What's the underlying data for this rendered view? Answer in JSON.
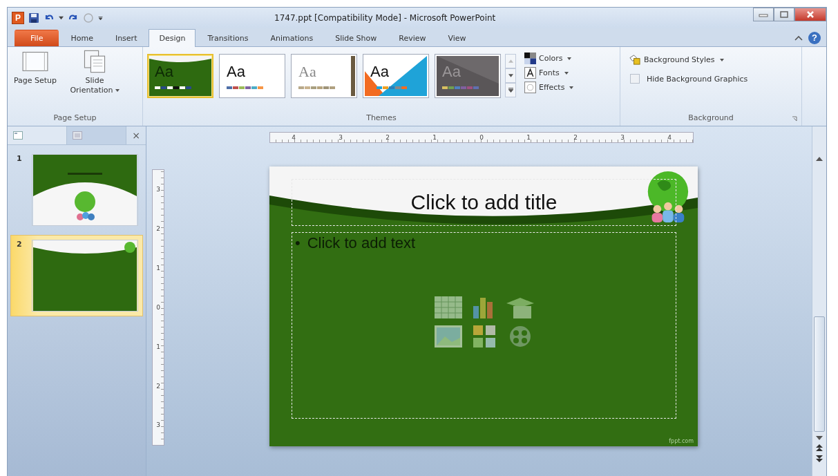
{
  "window": {
    "app_icon_letter": "P",
    "title": "1747.ppt [Compatibility Mode] - Microsoft PowerPoint"
  },
  "tabs": [
    {
      "label": "File",
      "kind": "file",
      "selected": false
    },
    {
      "label": "Home",
      "kind": "tab",
      "selected": false
    },
    {
      "label": "Insert",
      "kind": "tab",
      "selected": false
    },
    {
      "label": "Design",
      "kind": "tab",
      "selected": true
    },
    {
      "label": "Transitions",
      "kind": "tab",
      "selected": false
    },
    {
      "label": "Animations",
      "kind": "tab",
      "selected": false
    },
    {
      "label": "Slide Show",
      "kind": "tab",
      "selected": false
    },
    {
      "label": "Review",
      "kind": "tab",
      "selected": false
    },
    {
      "label": "View",
      "kind": "tab",
      "selected": false
    }
  ],
  "help": "?",
  "page_setup": {
    "buttons": [
      {
        "label": "Page Setup",
        "kind": "page",
        "dropdown": false
      },
      {
        "label": "Slide Orientation",
        "kind": "orientation",
        "dropdown": true
      }
    ],
    "group_label": "Page Setup"
  },
  "themes": {
    "items": [
      {
        "kind": "green",
        "sample": "Aa",
        "selected": true
      },
      {
        "kind": "office",
        "sample": "Aa",
        "selected": false
      },
      {
        "kind": "paper",
        "sample": "Aa",
        "selected": false
      },
      {
        "kind": "angles",
        "sample": "Aa",
        "selected": false
      },
      {
        "kind": "dark",
        "sample": "Aa",
        "selected": false
      }
    ],
    "options": [
      {
        "label": "Colors",
        "kind": "colors"
      },
      {
        "label": "Fonts",
        "kind": "fonts"
      },
      {
        "label": "Effects",
        "kind": "effects"
      }
    ],
    "group_label": "Themes"
  },
  "background": {
    "styles_label": "Background Styles",
    "hide_graphics": {
      "label": "Hide Background Graphics",
      "checked": false
    },
    "group_label": "Background"
  },
  "pane": {
    "tabs": [
      {
        "kind": "slides",
        "selected": true
      },
      {
        "kind": "outline",
        "selected": false
      }
    ],
    "close": "×"
  },
  "slides": [
    {
      "number": "1",
      "kind": "title",
      "selected": false
    },
    {
      "number": "2",
      "kind": "content",
      "selected": true
    }
  ],
  "rulers": {
    "horizontal": [
      "4",
      "3",
      "2",
      "1",
      "0",
      "1",
      "2",
      "3",
      "4"
    ],
    "vertical": [
      "3",
      "2",
      "1",
      "0",
      "1",
      "2",
      "3"
    ]
  },
  "slide": {
    "title_placeholder": "Click to add title",
    "body_placeholder": "Click to add text",
    "bullet": "•",
    "footer": "fppt.com"
  }
}
